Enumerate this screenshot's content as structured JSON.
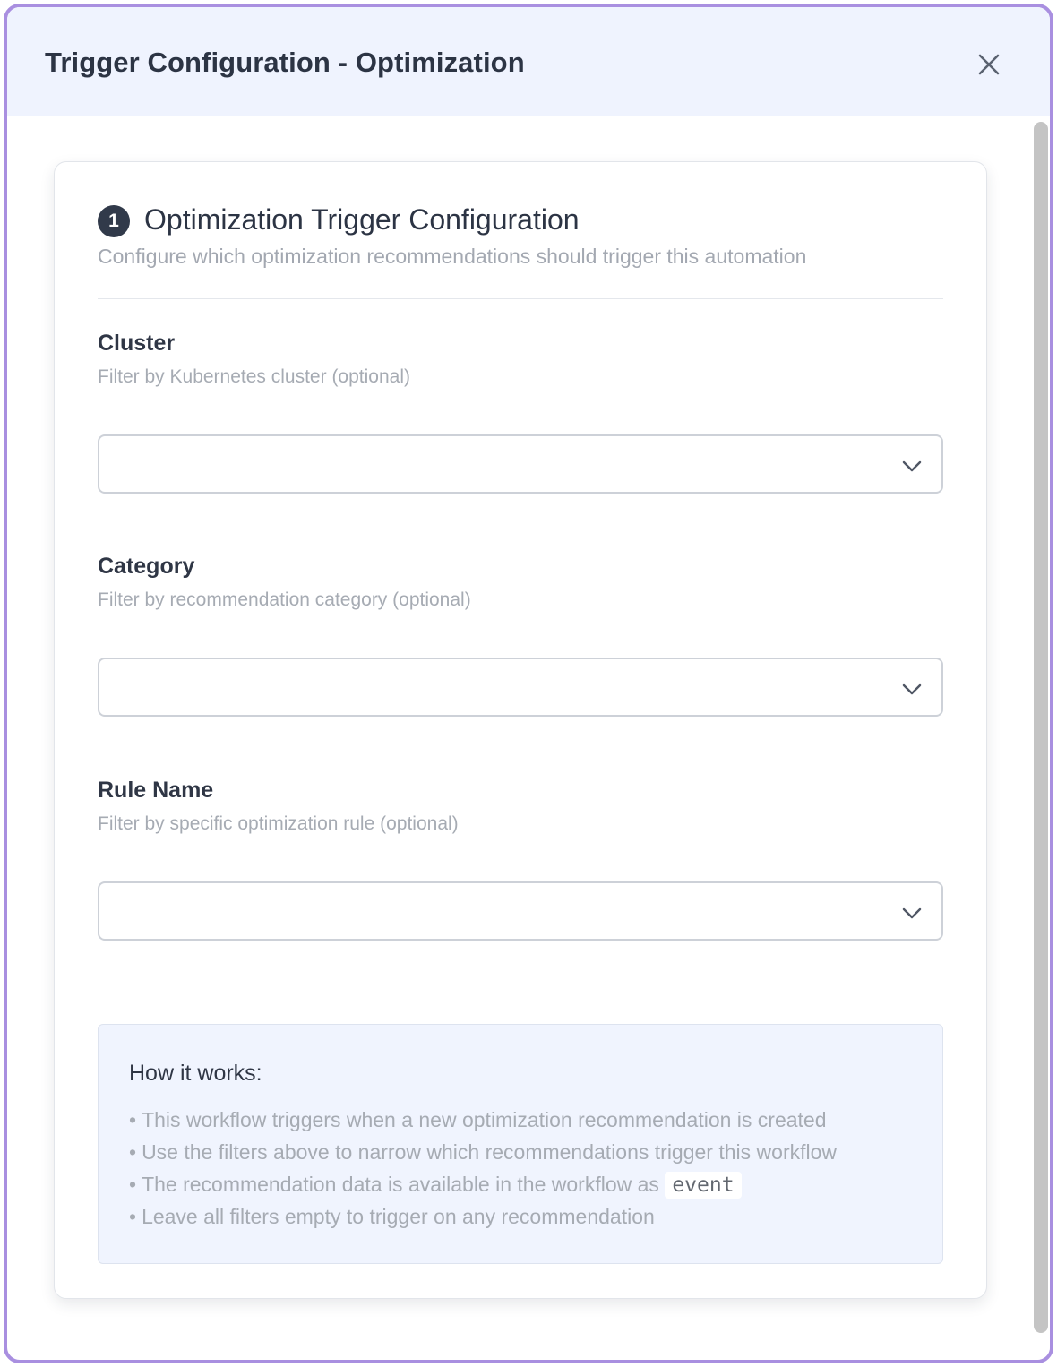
{
  "modal": {
    "title": "Trigger Configuration - Optimization",
    "close_icon": "close-icon"
  },
  "section": {
    "step_number": "1",
    "title": "Optimization Trigger Configuration",
    "subtitle": "Configure which optimization recommendations should trigger this automation"
  },
  "fields": {
    "cluster": {
      "label": "Cluster",
      "help": "Filter by Kubernetes cluster (optional)",
      "value": ""
    },
    "category": {
      "label": "Category",
      "help": "Filter by recommendation category (optional)",
      "value": ""
    },
    "rule_name": {
      "label": "Rule Name",
      "help": "Filter by specific optimization rule (optional)",
      "value": ""
    }
  },
  "info": {
    "title": "How it works:",
    "bullet": "•",
    "items": [
      "This workflow triggers when a new optimization recommendation is created",
      "Use the filters above to narrow which recommendations trigger this workflow",
      "The recommendation data is available in the workflow as",
      "Leave all filters empty to trigger on any recommendation"
    ],
    "code": "event"
  },
  "colors": {
    "modal_border": "#a98fe0",
    "header_bg": "#eff3fe",
    "info_bg": "#f0f4fe",
    "badge_bg": "#313a4a"
  }
}
